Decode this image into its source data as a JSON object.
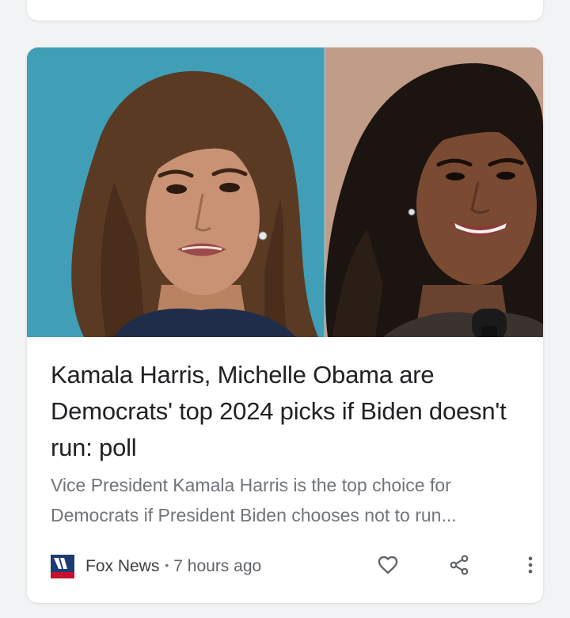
{
  "article": {
    "headline": "Kamala Harris, Michelle Obama are Democrats' top 2024 picks if Biden doesn't run: poll",
    "snippet": "Vice President Kamala Harris is the top choice for Democrats if President Biden chooses not to run...",
    "source": "Fox News",
    "separator": "•",
    "time": "7 hours ago"
  },
  "icons": {
    "source_logo": "fox-news-logo",
    "like": "heart-icon",
    "share": "share-icon",
    "more": "more-vert-icon"
  },
  "colors": {
    "background": "#f1f3f4",
    "card": "#ffffff",
    "headline": "#202124",
    "snippet": "#70757a",
    "icon": "#5f6368",
    "logo_navy": "#1c3b73",
    "logo_red": "#c8102e"
  }
}
